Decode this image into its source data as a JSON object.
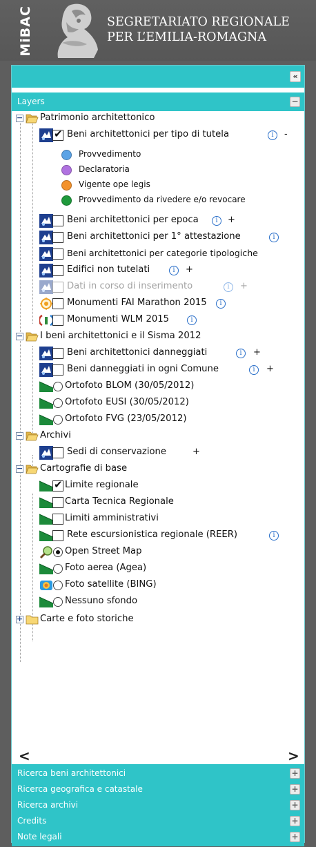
{
  "header": {
    "logo_text": "MiBAC",
    "org_line1": "SEGRETARIATO REGIONALE",
    "org_line2": "PER L’EMILIA-ROMAGNA"
  },
  "panel": {
    "collapse_symbol": "«",
    "layers_title": "Layers",
    "expanded_symbol": "−",
    "collapsed_symbol": "+"
  },
  "tree": {
    "group1": {
      "label": "Patrimonio architettonico",
      "items": [
        {
          "label": "Beni architettonici per tipo di tutela",
          "checked": true,
          "suffix": "-"
        },
        {
          "label": "Beni architettonici per epoca",
          "suffix": "+"
        },
        {
          "label": "Beni architettonici per 1° attestazione"
        },
        {
          "label": "Beni architettonici per categorie tipologiche"
        },
        {
          "label": "Edifici non tutelati",
          "suffix": "+"
        },
        {
          "label": "Dati in corso di inserimento",
          "suffix": "+",
          "disabled": true
        },
        {
          "label": "Monumenti FAI Marathon 2015"
        },
        {
          "label": "Monumenti WLM 2015"
        }
      ],
      "legend": [
        {
          "label": "Provvedimento",
          "color": "#5ba3e6"
        },
        {
          "label": "Declaratoria",
          "color": "#b072e0"
        },
        {
          "label": "Vigente ope legis",
          "color": "#f3922c"
        },
        {
          "label": "Provvedimento da rivedere e/o revocare",
          "color": "#1f9a3c"
        }
      ]
    },
    "group2": {
      "label": "I beni architettonici e il Sisma 2012",
      "items": [
        {
          "label": "Beni architettonici danneggiati",
          "suffix": "+"
        },
        {
          "label": "Beni danneggiati in ogni Comune",
          "suffix": "+"
        },
        {
          "label": "Ortofoto BLOM (30/05/2012)"
        },
        {
          "label": "Ortofoto EUSI (30/05/2012)"
        },
        {
          "label": "Ortofoto FVG (23/05/2012)"
        }
      ]
    },
    "group3": {
      "label": "Archivi",
      "items": [
        {
          "label": "Sedi di conservazione",
          "suffix": "+"
        }
      ]
    },
    "group4": {
      "label": "Cartografie di base",
      "items": [
        {
          "label": "Limite regionale",
          "checked": true
        },
        {
          "label": "Carta Tecnica Regionale"
        },
        {
          "label": "Limiti amministrativi"
        },
        {
          "label": "Rete escursionistica regionale (REER)"
        },
        {
          "label": "Open Street Map",
          "selected": true
        },
        {
          "label": "Foto aerea (Agea)"
        },
        {
          "label": "Foto satellite (BING)"
        },
        {
          "label": "Nessuno sfondo"
        }
      ]
    },
    "group5": {
      "label": "Carte e foto storiche"
    },
    "info_symbol": "i"
  },
  "scroll": {
    "left_arrow": "<",
    "right_arrow": ">"
  },
  "accordion": [
    {
      "label": "Ricerca beni architettonici"
    },
    {
      "label": "Ricerca geografica e catastale"
    },
    {
      "label": "Ricerca archivi"
    },
    {
      "label": "Credits"
    },
    {
      "label": "Note legali"
    }
  ],
  "colors": {
    "accent": "#2fc4c8",
    "header_bg": "#5e5e5e",
    "info_blue": "#2a6fc9"
  }
}
